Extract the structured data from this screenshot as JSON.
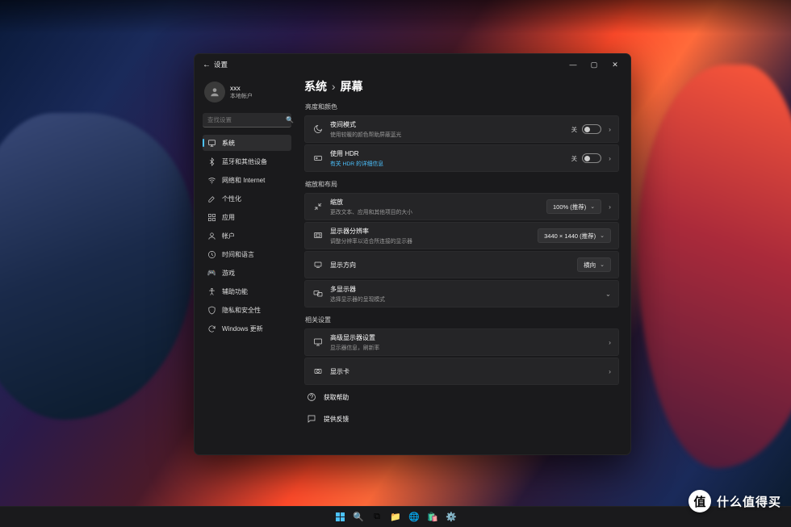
{
  "window": {
    "title": "设置"
  },
  "profile": {
    "name": "xxx",
    "subtitle": "本地帐户"
  },
  "search": {
    "placeholder": "查找设置"
  },
  "nav": [
    {
      "label": "系统",
      "icon": "system"
    },
    {
      "label": "蓝牙和其他设备",
      "icon": "bluetooth"
    },
    {
      "label": "网络和 Internet",
      "icon": "network"
    },
    {
      "label": "个性化",
      "icon": "personalization"
    },
    {
      "label": "应用",
      "icon": "apps"
    },
    {
      "label": "帐户",
      "icon": "accounts"
    },
    {
      "label": "时间和语言",
      "icon": "time"
    },
    {
      "label": "游戏",
      "icon": "gaming"
    },
    {
      "label": "辅助功能",
      "icon": "accessibility"
    },
    {
      "label": "隐私和安全性",
      "icon": "privacy"
    },
    {
      "label": "Windows 更新",
      "icon": "update"
    }
  ],
  "breadcrumb": {
    "parent": "系统",
    "current": "屏幕"
  },
  "sections": {
    "brightness": {
      "header": "亮度和颜色",
      "night": {
        "title": "夜间模式",
        "sub": "使用较暖的颜色帮助屏蔽蓝光",
        "state": "关"
      },
      "hdr": {
        "title": "使用 HDR",
        "sub": "有关 HDR 的详细信息",
        "state": "关"
      }
    },
    "scale": {
      "header": "缩放和布局",
      "zoom": {
        "title": "缩放",
        "sub": "更改文本、应用和其他项目的大小",
        "value": "100% (推荐)"
      },
      "res": {
        "title": "显示器分辨率",
        "sub": "调整分辨率以适合所连接的显示器",
        "value": "3440 × 1440 (推荐)"
      },
      "orient": {
        "title": "显示方向",
        "value": "横向"
      },
      "multi": {
        "title": "多显示器",
        "sub": "选择显示器的呈现模式"
      }
    },
    "related": {
      "header": "相关设置",
      "adv": {
        "title": "高级显示器设置",
        "sub": "显示器信息，刷新率"
      },
      "gpu": {
        "title": "显示卡"
      }
    },
    "help": {
      "title": "获取帮助"
    },
    "feedback": {
      "title": "提供反馈"
    }
  },
  "watermark": {
    "badge": "值",
    "text": "什么值得买"
  }
}
